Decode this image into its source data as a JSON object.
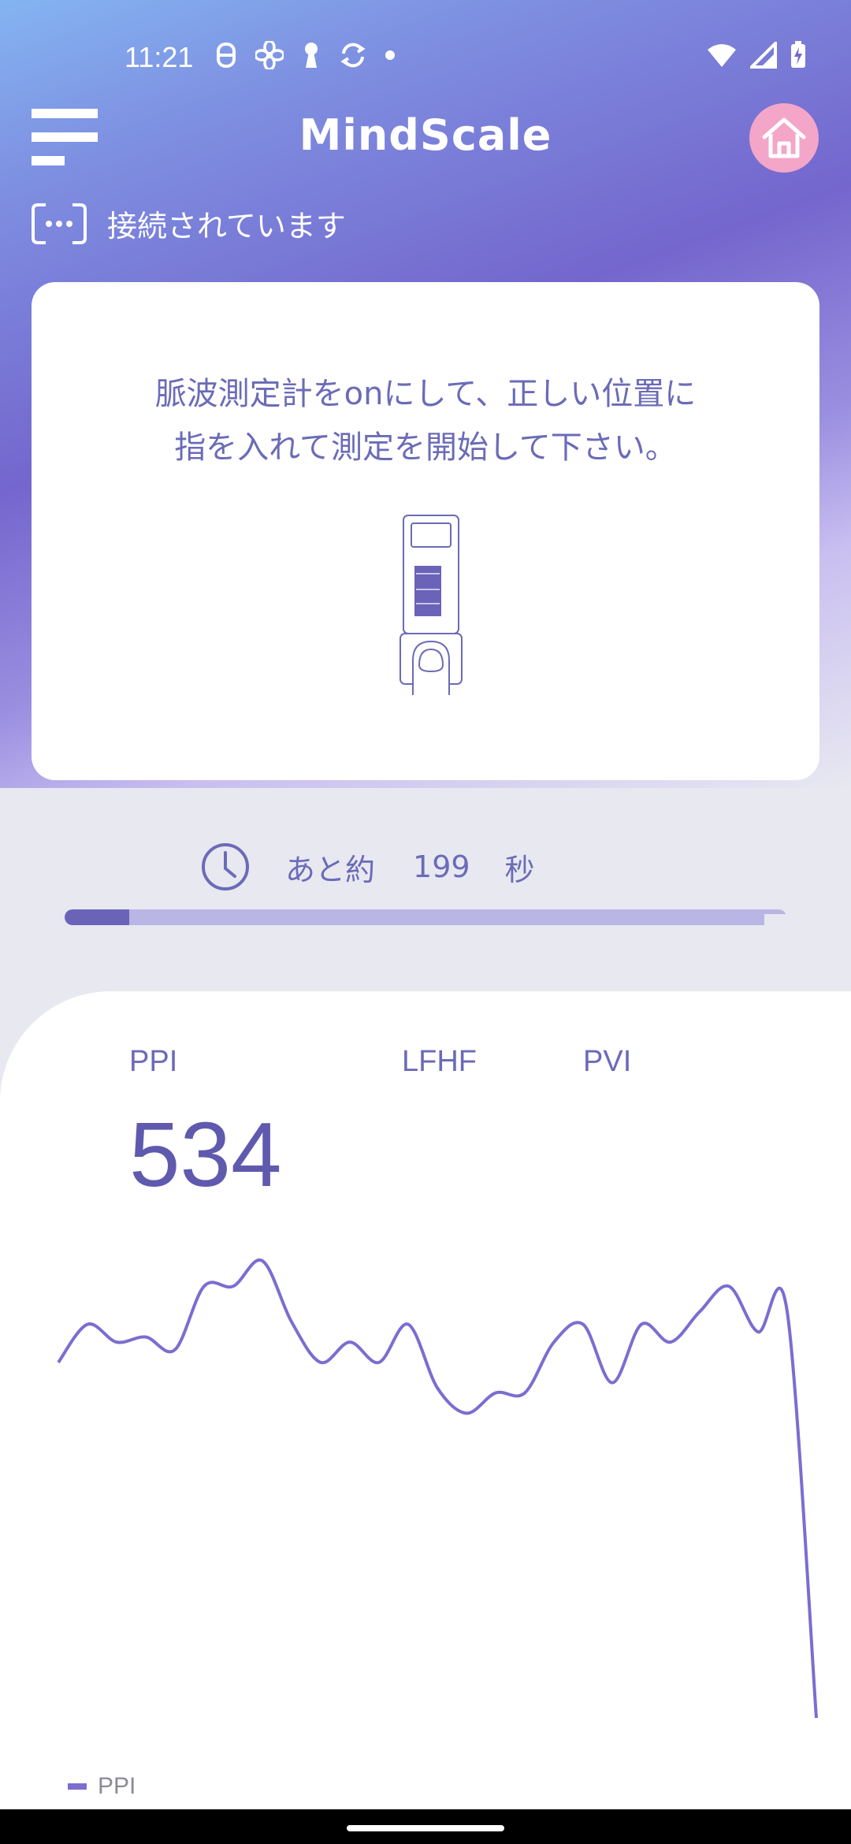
{
  "status_bar": {
    "time": "11:21"
  },
  "header": {
    "title": "MindScale"
  },
  "connection": {
    "status_text": "接続されています"
  },
  "card": {
    "instruction_line1": "脈波測定計をonにして、正しい位置に",
    "instruction_line2": "指を入れて測定を開始して下さい。"
  },
  "timer": {
    "label": "あと約",
    "remaining_seconds": "199",
    "unit": "秒",
    "progress_fraction": 0.09
  },
  "metrics": {
    "tabs": [
      "PPI",
      "LFHF",
      "PVI"
    ],
    "value": "534"
  },
  "chart_data": {
    "type": "line",
    "series": [
      {
        "name": "PPI",
        "values": [
          660,
          675,
          668,
          670,
          665,
          690,
          690,
          700,
          676,
          660,
          668,
          660,
          675,
          650,
          640,
          648,
          648,
          668,
          675,
          652,
          675,
          668,
          680,
          690,
          672,
          680,
          520
        ]
      }
    ],
    "legend": [
      "PPI"
    ],
    "grid": false
  },
  "colors": {
    "accent": "#6b6bb8",
    "line": "#7a6ed0",
    "home_button": "#f3a6c8"
  }
}
